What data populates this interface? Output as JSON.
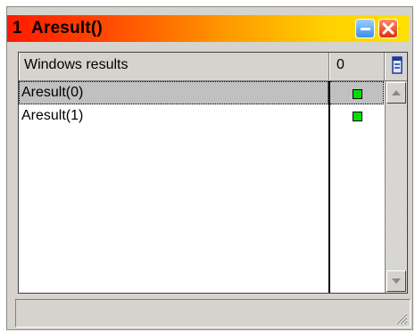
{
  "window": {
    "title": "1  Aresult()",
    "controls": {
      "minimize_icon": "minimize-icon",
      "close_icon": "close-icon"
    }
  },
  "table": {
    "columns": [
      "Windows results",
      "0"
    ],
    "column_menu_icon": "column-settings-icon",
    "rows": [
      {
        "label": "Aresult(0)",
        "status_color": "#00e000",
        "selected": true
      },
      {
        "label": "Aresult(1)",
        "status_color": "#00e000",
        "selected": false
      }
    ]
  },
  "status_bar": {
    "text": ""
  },
  "colors": {
    "title_gradient_start": "#ff1a00",
    "title_gradient_end": "#ffe000",
    "selection": "#c0c0c0",
    "indicator": "#00e000"
  }
}
